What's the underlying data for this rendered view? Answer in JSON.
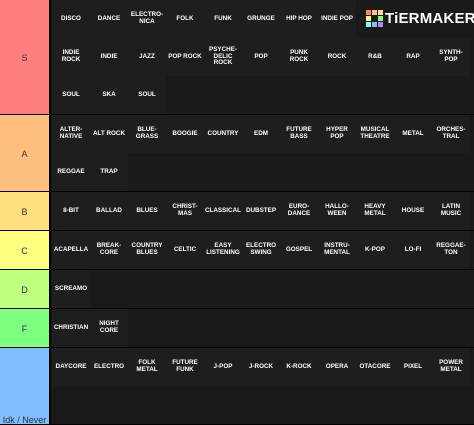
{
  "brand": {
    "name": "TiERMAKER",
    "grid_colors": [
      "#ff7f7f",
      "#ffbf7f",
      "#ffdf7f",
      "#ffff7f",
      "#bfff7f",
      "#7fff7f",
      "#7fffff",
      "#7fbfff",
      "#bf7fff"
    ]
  },
  "tiers": [
    {
      "label": "S",
      "color": "#ff7f7f",
      "items": [
        "DISCO",
        "DANCE",
        "ELECTRO-\nNICA",
        "FOLK",
        "FUNK",
        "GRUNGE",
        "HIP HOP",
        "INDIE POP",
        "",
        "",
        "",
        "INDIE\nROCK",
        "INDIE",
        "JAZZ",
        "POP ROCK",
        "PSYCHE-\nDELIC\nROCK",
        "POP",
        "PUNK\nROCK",
        "ROCK",
        "R&B",
        "RAP",
        "SYNTH-\nPOP",
        "SOUL",
        "SKA",
        "SOUL"
      ]
    },
    {
      "label": "A",
      "color": "#ffbf7f",
      "items": [
        "ALTER-\nNATIVE",
        "ALT ROCK",
        "BLUE-\nGRASS",
        "BOOGIE",
        "COUNTRY",
        "EDM",
        "FUTURE\nBASS",
        "HYPER\nPOP",
        "MUSICAL\nTHEATRE",
        "METAL",
        "ORCHES-\nTRAL",
        "REGGAE",
        "TRAP"
      ]
    },
    {
      "label": "B",
      "color": "#ffdf7f",
      "items": [
        "8-BIT",
        "BALLAD",
        "BLUES",
        "CHRIST-\nMAS",
        "CLASSICAL",
        "DUBSTEP",
        "EURO-\nDANCE",
        "HALLO-\nWEEN",
        "HEAVY\nMETAL",
        "HOUSE",
        "LATIN\nMUSIC"
      ]
    },
    {
      "label": "C",
      "color": "#ffff7f",
      "items": [
        "ACAPELLA",
        "BREAK-\nCORE",
        "COUNTRY\nBLUES",
        "CELTIC",
        "EASY\nLISTENING",
        "ELECTRO\nSWING",
        "GOSPEL",
        "INSTRU-\nMENTAL",
        "K-POP",
        "LO-FI",
        "REGGAE-\nTON"
      ]
    },
    {
      "label": "D",
      "color": "#bfff7f",
      "items": [
        "SCREAMO"
      ]
    },
    {
      "label": "F",
      "color": "#7fff7f",
      "items": [
        "CHRISTIAN",
        "NIGHT\nCORE"
      ]
    },
    {
      "label": "Idk / Never",
      "color": "#7fbfff",
      "items": [
        "DAYCORE",
        "ELECTRO",
        "FOLK\nMETAL",
        "FUTURE\nFUNK",
        "J-POP",
        "J-ROCK",
        "K-ROCK",
        "OPERA",
        "OTACORE",
        "PIXEL",
        "POWER\nMETAL"
      ]
    }
  ]
}
